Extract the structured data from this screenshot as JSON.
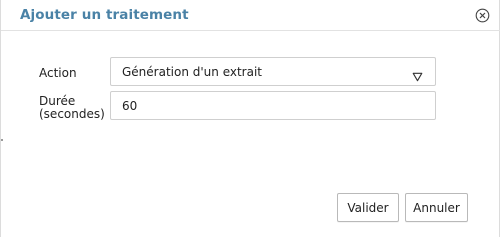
{
  "dialog": {
    "title": "Ajouter un traitement",
    "close_icon": "close-circle-icon"
  },
  "form": {
    "action_label": "Action",
    "action_value": "Génération d'un extrait",
    "action_dropdown_icon": "chevron-down-icon",
    "duration_label_line1": "Durée",
    "duration_label_line2": "(secondes)",
    "duration_value": "60"
  },
  "footer": {
    "validate_label": "Valider",
    "cancel_label": "Annuler"
  },
  "colors": {
    "title": "#4a82a6",
    "border": "#cfcfcf"
  }
}
